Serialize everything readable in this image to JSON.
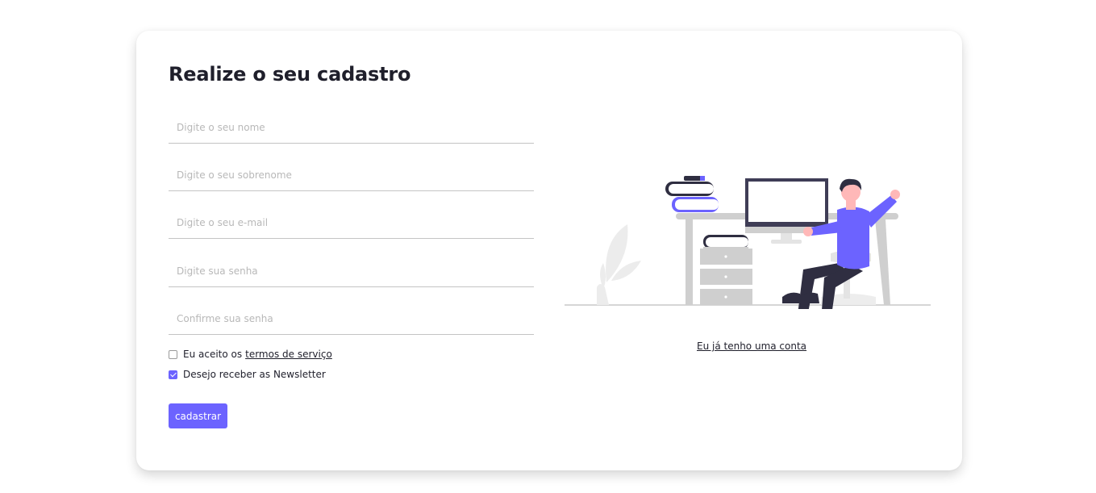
{
  "form": {
    "title": "Realize o seu cadastro",
    "fields": [
      {
        "placeholder": "Digite o seu nome",
        "value": ""
      },
      {
        "placeholder": "Digite o seu sobrenome",
        "value": ""
      },
      {
        "placeholder": "Digite o seu e-mail",
        "value": ""
      },
      {
        "placeholder": "Digite sua senha",
        "value": ""
      },
      {
        "placeholder": "Confirme sua senha",
        "value": ""
      }
    ],
    "terms": {
      "label": "Eu aceito os",
      "link": "termos de serviço",
      "checked": false
    },
    "newsletter": {
      "label": "Desejo receber as Newsletter",
      "checked": true
    },
    "submit_label": "cadastrar"
  },
  "aside": {
    "illustration_icon": "person-at-desk-illustration",
    "login_link": "Eu já tenho uma conta"
  },
  "colors": {
    "accent": "#6c63ff",
    "text": "#1f1f2b",
    "input_border": "#c4c4c4",
    "placeholder": "#b8b8b8"
  }
}
